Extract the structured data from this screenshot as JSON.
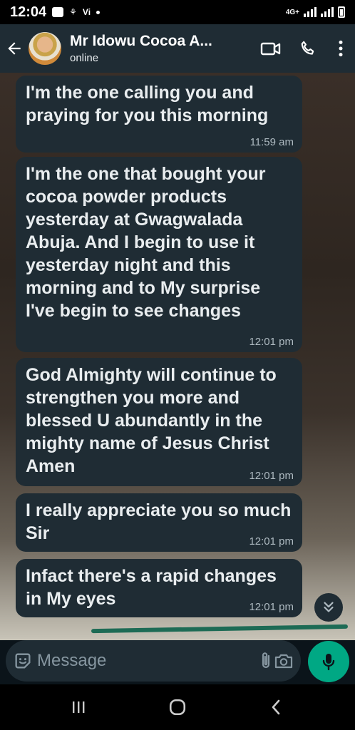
{
  "status_bar": {
    "time": "12:04",
    "carrier": "Vi",
    "network": "4G+"
  },
  "header": {
    "contact_name": "Mr Idowu Cocoa A...",
    "status": "online"
  },
  "messages": [
    {
      "text": "I'm the one calling you and praying for you this morning",
      "time": "11:59 am"
    },
    {
      "text": "I'm the one that bought your cocoa powder products yesterday at Gwagwalada Abuja. And I begin to use it yesterday night and this morning and to My surprise I've begin to see changes",
      "time": "12:01 pm"
    },
    {
      "text": "God Almighty will continue to strengthen you more and blessed U abundantly in the mighty name of Jesus Christ Amen",
      "time": "12:01 pm"
    },
    {
      "text": "I really appreciate you so much Sir",
      "time": "12:01 pm"
    },
    {
      "text": "Infact there's a rapid changes in My eyes",
      "time": "12:01 pm"
    }
  ],
  "input": {
    "placeholder": "Message",
    "value": ""
  },
  "icons": {
    "back": "arrow-left-icon",
    "video": "video-call-icon",
    "call": "phone-icon",
    "menu": "more-vert-icon",
    "emoji": "emoji-icon",
    "attach": "paperclip-icon",
    "camera": "camera-icon",
    "mic": "microphone-icon",
    "scroll": "double-chevron-down-icon"
  },
  "colors": {
    "header_bg": "#1f2c34",
    "bubble_bg": "#1f2c34",
    "accent": "#00a884",
    "time_text": "#aebac1"
  }
}
